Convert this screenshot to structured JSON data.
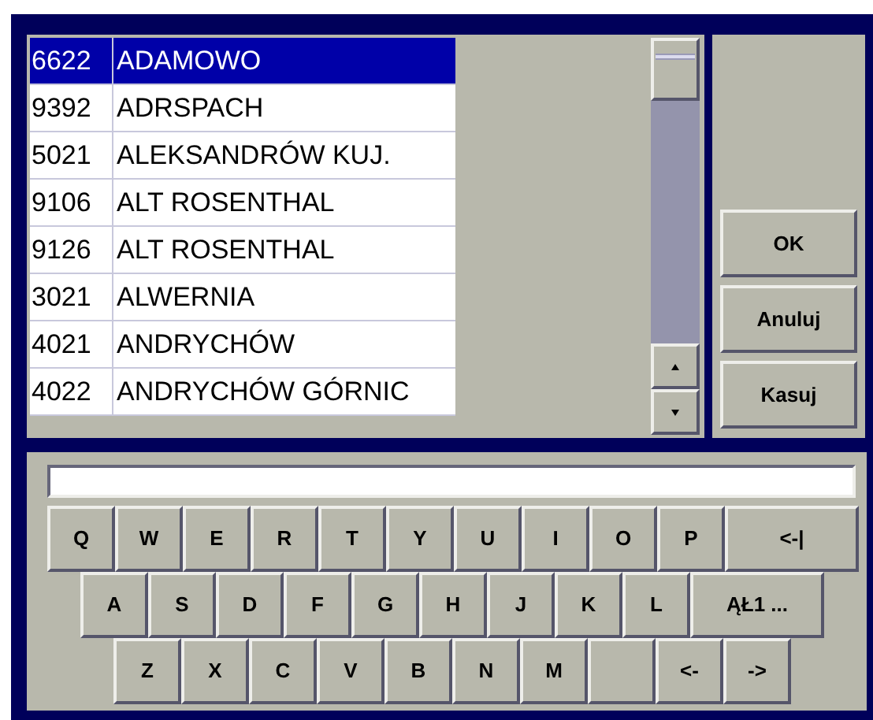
{
  "list": {
    "rows": [
      {
        "code": "6622",
        "name": "ADAMOWO",
        "selected": true
      },
      {
        "code": "9392",
        "name": "ADRSPACH",
        "selected": false
      },
      {
        "code": "5021",
        "name": "ALEKSANDRÓW KUJ.",
        "selected": false
      },
      {
        "code": "9106",
        "name": "ALT ROSENTHAL",
        "selected": false
      },
      {
        "code": "9126",
        "name": "ALT ROSENTHAL",
        "selected": false
      },
      {
        "code": "3021",
        "name": "ALWERNIA",
        "selected": false
      },
      {
        "code": "4021",
        "name": "ANDRYCHÓW",
        "selected": false
      },
      {
        "code": "4022",
        "name": "ANDRYCHÓW GÓRNIC",
        "selected": false
      }
    ]
  },
  "buttons": [
    "OK",
    "Anuluj",
    "Kasuj"
  ],
  "keyboard": {
    "rows": [
      [
        {
          "kind": "key",
          "label": "Q"
        },
        {
          "kind": "key",
          "label": "W"
        },
        {
          "kind": "key",
          "label": "E"
        },
        {
          "kind": "key",
          "label": "R"
        },
        {
          "kind": "key",
          "label": "T"
        },
        {
          "kind": "key",
          "label": "Y"
        },
        {
          "kind": "key",
          "label": "U"
        },
        {
          "kind": "key",
          "label": "I"
        },
        {
          "kind": "key",
          "label": "O"
        },
        {
          "kind": "key",
          "label": "P"
        },
        {
          "kind": "wide",
          "label": "<-|"
        }
      ],
      [
        {
          "kind": "key",
          "label": "A"
        },
        {
          "kind": "key",
          "label": "S"
        },
        {
          "kind": "key",
          "label": "D"
        },
        {
          "kind": "key",
          "label": "F"
        },
        {
          "kind": "key",
          "label": "G"
        },
        {
          "kind": "key",
          "label": "H"
        },
        {
          "kind": "key",
          "label": "J"
        },
        {
          "kind": "key",
          "label": "K"
        },
        {
          "kind": "key",
          "label": "L"
        },
        {
          "kind": "wide",
          "label": "ĄŁ1 ..."
        }
      ],
      [
        {
          "kind": "key",
          "label": "Z"
        },
        {
          "kind": "key",
          "label": "X"
        },
        {
          "kind": "key",
          "label": "C"
        },
        {
          "kind": "key",
          "label": "V"
        },
        {
          "kind": "key",
          "label": "B"
        },
        {
          "kind": "key",
          "label": "N"
        },
        {
          "kind": "key",
          "label": "M"
        },
        {
          "kind": "blank"
        },
        {
          "kind": "key",
          "label": "<-"
        },
        {
          "kind": "key",
          "label": "->"
        }
      ]
    ]
  }
}
